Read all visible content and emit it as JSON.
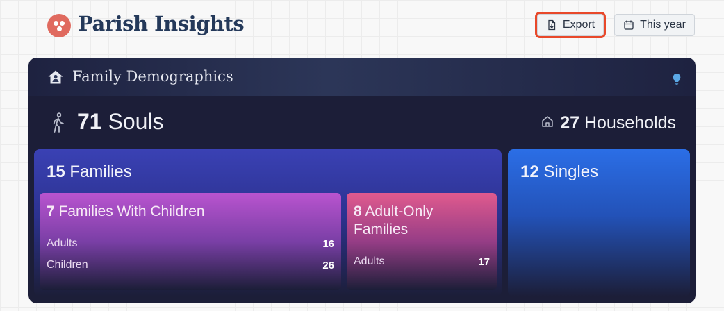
{
  "header": {
    "app_title": "Parish Insights",
    "logo_icon": "parish-logo-icon",
    "export_label": "Export",
    "export_icon": "file-export-icon",
    "period_label": "This year",
    "period_icon": "calendar-icon",
    "highlight_color": "#e8482a"
  },
  "card": {
    "title": "Family Demographics",
    "title_icon": "home-icon",
    "info_icon": "lightbulb-icon",
    "souls": {
      "count": "71",
      "label": "Souls",
      "icon": "walking-person-icon"
    },
    "households": {
      "count": "27",
      "label": "Households",
      "icon": "house-outline-icon"
    },
    "families": {
      "count": "15",
      "label": "Families",
      "with_children": {
        "count": "7",
        "label": "Families With Children",
        "rows": [
          {
            "label": "Adults",
            "value": "16"
          },
          {
            "label": "Children",
            "value": "26"
          }
        ]
      },
      "adult_only": {
        "count": "8",
        "label_line1": "Adult-Only",
        "label_line2": "Families",
        "rows": [
          {
            "label": "Adults",
            "value": "17"
          }
        ]
      }
    },
    "singles": {
      "count": "12",
      "label": "Singles"
    }
  },
  "colors": {
    "card_bg": "#1c1e38",
    "families_bg": "#3a41b4",
    "children_bg": "#b954cf",
    "adult_only_bg": "#e05a8e",
    "singles_bg": "#2b6ee6",
    "title_color": "#24395a",
    "logo_color": "#e06a5f"
  }
}
